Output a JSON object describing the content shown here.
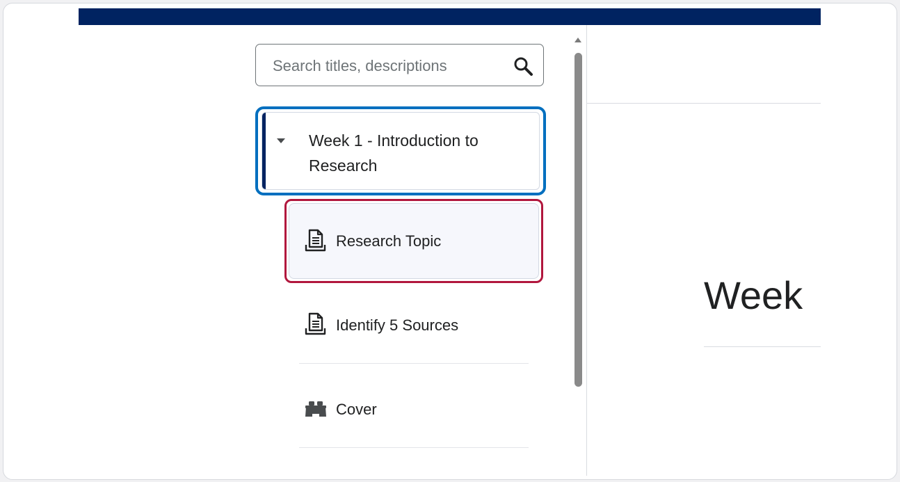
{
  "search": {
    "placeholder": "Search titles, descriptions"
  },
  "toc": {
    "module": {
      "title": "Week 1 - Introduction to Research",
      "expanded": true
    },
    "items": [
      {
        "label": "Research Topic",
        "icon": "document-icon",
        "selected": true
      },
      {
        "label": "Identify 5 Sources",
        "icon": "document-icon",
        "selected": false
      },
      {
        "label": "Cover",
        "icon": "lego-block-icon",
        "selected": false
      }
    ]
  },
  "main": {
    "heading": "Week"
  },
  "colors": {
    "brand_bar": "#002361",
    "focus_ring": "#006fbf",
    "highlight_ring": "#b1173d",
    "selected_bg": "#f6f7fc",
    "text": "#202122"
  }
}
